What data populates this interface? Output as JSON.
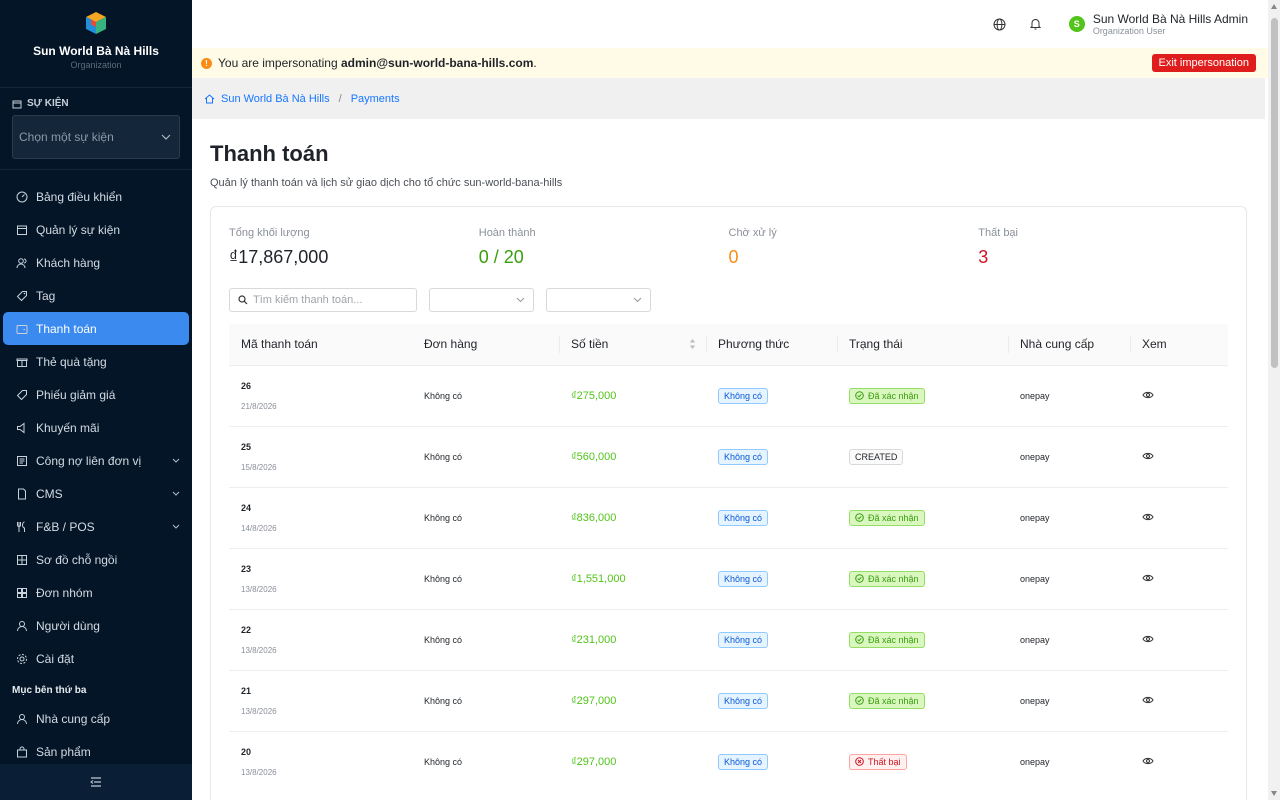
{
  "brand": {
    "name": "Sun World Bà Nà Hills",
    "sub": "Organization"
  },
  "sidebar": {
    "event_section": "SỰ KIỆN",
    "event_select_placeholder": "Chọn một sự kiện",
    "items": [
      {
        "label": "Bảng điều khiển",
        "icon": "dashboard-icon"
      },
      {
        "label": "Quản lý sự kiện",
        "icon": "calendar-icon"
      },
      {
        "label": "Khách hàng",
        "icon": "users-icon"
      },
      {
        "label": "Tag",
        "icon": "tag-icon"
      },
      {
        "label": "Thanh toán",
        "icon": "wallet-icon",
        "active": true
      },
      {
        "label": "Thẻ quà tặng",
        "icon": "gift-icon"
      },
      {
        "label": "Phiếu giảm giá",
        "icon": "coupon-icon"
      },
      {
        "label": "Khuyến mãi",
        "icon": "sound-icon"
      },
      {
        "label": "Công nợ liên đơn vị",
        "icon": "ledger-icon",
        "expandable": true
      },
      {
        "label": "CMS",
        "icon": "cms-icon",
        "expandable": true
      },
      {
        "label": "F&B / POS",
        "icon": "fnb-icon",
        "expandable": true
      },
      {
        "label": "Sơ đồ chỗ ngồi",
        "icon": "seatmap-icon"
      },
      {
        "label": "Đơn nhóm",
        "icon": "group-order-icon"
      },
      {
        "label": "Người dùng",
        "icon": "user-icon"
      },
      {
        "label": "Cài đặt",
        "icon": "gear-icon"
      }
    ],
    "third_party_label": "Mục bên thứ ba",
    "third_party_items": [
      {
        "label": "Nhà cung cấp",
        "icon": "user-icon"
      },
      {
        "label": "Sản phẩm",
        "icon": "bag-icon"
      }
    ]
  },
  "header": {
    "user_name": "Sun World Bà Nà Hills Admin",
    "user_role": "Organization User",
    "avatar_letter": "S"
  },
  "impersonation": {
    "prefix": "You are impersonating ",
    "email": "admin@sun-world-bana-hills.com",
    "suffix": ".",
    "exit_label": "Exit impersonation"
  },
  "breadcrumb": {
    "home": "Sun World Bà Nà Hills",
    "current": "Payments"
  },
  "page": {
    "title": "Thanh toán",
    "description": "Quản lý thanh toán và lịch sử giao dịch cho tổ chức sun-world-bana-hills"
  },
  "stats": [
    {
      "label": "Tổng khối lượng",
      "value": "₫17,867,000",
      "color": "#1f2329"
    },
    {
      "label": "Hoàn thành",
      "value": "0 / 20",
      "color": "#389e0d"
    },
    {
      "label": "Chờ xử lý",
      "value": "0",
      "color": "#fa8c16"
    },
    {
      "label": "Thất bại",
      "value": "3",
      "color": "#cf1322"
    }
  ],
  "search": {
    "placeholder": "Tìm kiếm thanh toán..."
  },
  "table": {
    "columns": [
      "Mã thanh toán",
      "Đơn hàng",
      "Số tiền",
      "Phương thức",
      "Trạng thái",
      "Nhà cung cấp",
      "Xem"
    ],
    "rows": [
      {
        "id": "26",
        "date": "21/8/2026",
        "order": "Không có",
        "amount": "₫275,000",
        "method": "Không có",
        "status": "Đã xác nhận",
        "status_type": "confirmed",
        "provider": "onepay"
      },
      {
        "id": "25",
        "date": "15/8/2026",
        "order": "Không có",
        "amount": "₫560,000",
        "method": "Không có",
        "status": "CREATED",
        "status_type": "created",
        "provider": "onepay"
      },
      {
        "id": "24",
        "date": "14/8/2026",
        "order": "Không có",
        "amount": "₫836,000",
        "method": "Không có",
        "status": "Đã xác nhận",
        "status_type": "confirmed",
        "provider": "onepay"
      },
      {
        "id": "23",
        "date": "13/8/2026",
        "order": "Không có",
        "amount": "₫1,551,000",
        "method": "Không có",
        "status": "Đã xác nhận",
        "status_type": "confirmed",
        "provider": "onepay"
      },
      {
        "id": "22",
        "date": "13/8/2026",
        "order": "Không có",
        "amount": "₫231,000",
        "method": "Không có",
        "status": "Đã xác nhận",
        "status_type": "confirmed",
        "provider": "onepay"
      },
      {
        "id": "21",
        "date": "13/8/2026",
        "order": "Không có",
        "amount": "₫297,000",
        "method": "Không có",
        "status": "Đã xác nhận",
        "status_type": "confirmed",
        "provider": "onepay"
      },
      {
        "id": "20",
        "date": "13/8/2026",
        "order": "Không có",
        "amount": "₫297,000",
        "method": "Không có",
        "status": "Thất bại",
        "status_type": "failed",
        "provider": "onepay"
      }
    ]
  }
}
